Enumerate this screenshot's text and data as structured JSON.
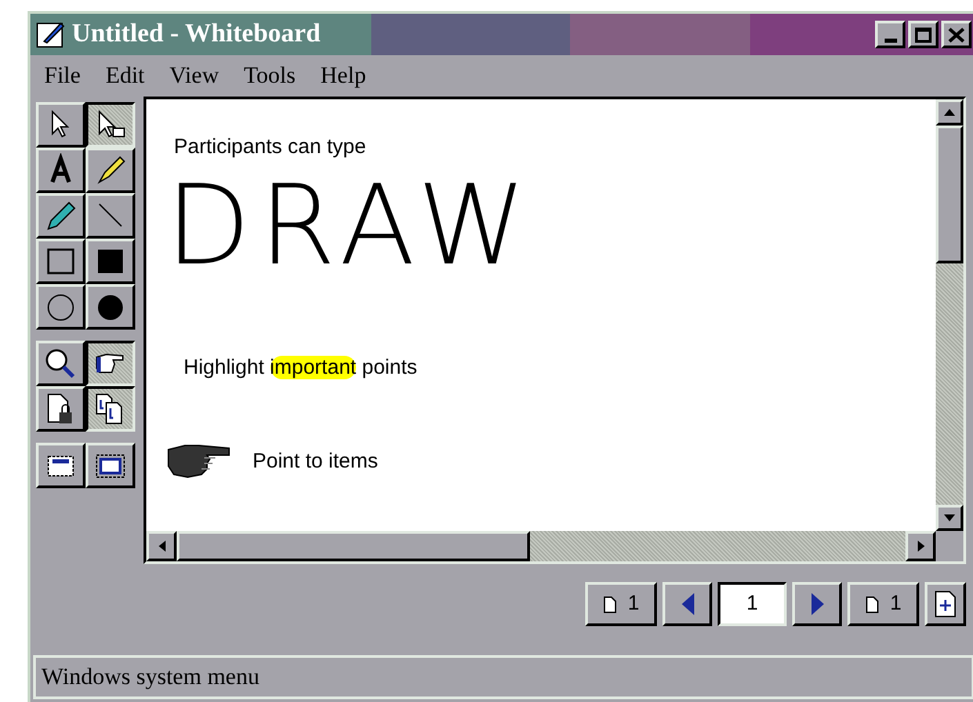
{
  "window": {
    "title": "Untitled - Whiteboard"
  },
  "menu": [
    "File",
    "Edit",
    "View",
    "Tools",
    "Help"
  ],
  "tool_groups": [
    [
      {
        "kind": "select",
        "selected": false
      },
      {
        "kind": "area",
        "selected": true
      },
      {
        "kind": "text",
        "selected": false
      },
      {
        "kind": "highlighter",
        "selected": false
      },
      {
        "kind": "pen",
        "selected": false
      },
      {
        "kind": "line",
        "selected": false
      },
      {
        "kind": "rect",
        "selected": false
      },
      {
        "kind": "filled-rect",
        "selected": false
      },
      {
        "kind": "ellipse",
        "selected": false
      },
      {
        "kind": "filled-ellipse",
        "selected": false
      }
    ],
    [
      {
        "kind": "zoom",
        "selected": false
      },
      {
        "kind": "pointer",
        "selected": true
      },
      {
        "kind": "lock",
        "selected": false
      },
      {
        "kind": "sync",
        "selected": true
      }
    ],
    [
      {
        "kind": "select-window",
        "selected": false
      },
      {
        "kind": "select-area",
        "selected": false
      }
    ]
  ],
  "canvas": {
    "typed_text": "Participants can type",
    "drawing_text": "DRAW",
    "highlight_line": [
      {
        "text": "Highlight ",
        "highlighted": false
      },
      {
        "text": "important",
        "highlighted": true
      },
      {
        "text": " points",
        "highlighted": false
      }
    ],
    "pointer_label": "Point to items"
  },
  "page_nav": {
    "first": "1",
    "current": "1",
    "last": "1"
  },
  "status_bar": "Windows system menu"
}
